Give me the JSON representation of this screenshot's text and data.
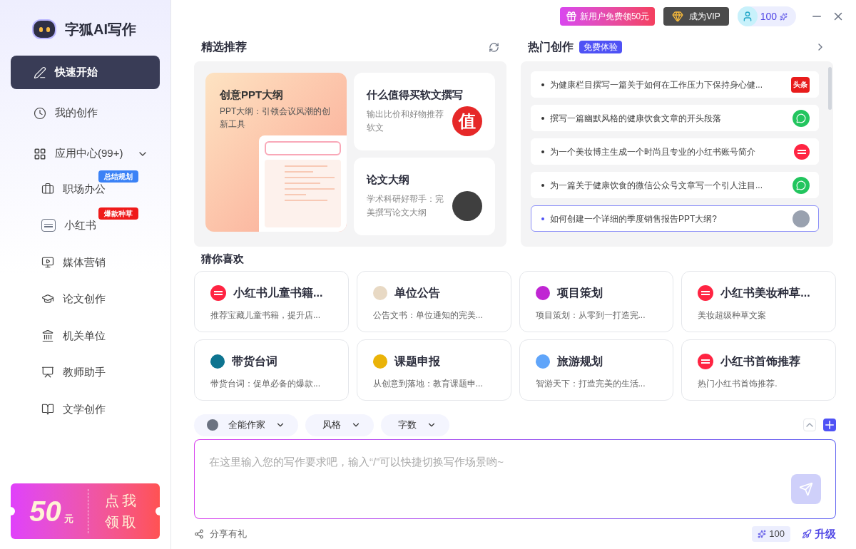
{
  "app": {
    "name": "字狐AI写作"
  },
  "sidebar": {
    "items": [
      {
        "label": "快速开始",
        "kind": "pen",
        "selected": true
      },
      {
        "label": "我的创作",
        "kind": "clock",
        "selected": false
      }
    ],
    "group": {
      "label": "应用中心(99+)",
      "expanded": true,
      "children": [
        {
          "label": "职场办公",
          "kind": "briefcase",
          "badge": "总结规划",
          "color": "#3b82f6"
        },
        {
          "label": "小红书",
          "kind": "note",
          "badge": "爆款种草",
          "color": "#ef1b1b"
        },
        {
          "label": "媒体营销",
          "kind": "video"
        },
        {
          "label": "论文创作",
          "kind": "cap"
        },
        {
          "label": "机关单位",
          "kind": "building"
        },
        {
          "label": "教师助手",
          "kind": "teacher"
        },
        {
          "label": "文学创作",
          "kind": "book"
        }
      ]
    },
    "coupon": {
      "amount": "50",
      "unit": "元",
      "action_lines": [
        "点我",
        "领取"
      ]
    }
  },
  "topbar": {
    "promo": "新用户免费领50元",
    "vip": "成为VIP",
    "credits": "100"
  },
  "featured": {
    "title": "精选推荐",
    "main_card": {
      "title": "创意PPT大纲",
      "desc": "PPT大纲：引领会议风潮的创新工具"
    },
    "cards": [
      {
        "title": "什么值得买软文撰写",
        "desc": "输出比价和好物推荐软文",
        "kind": "seal",
        "seal_text": "值"
      },
      {
        "title": "论文大纲",
        "desc": "学术科研好帮手：完美撰写论文大纲",
        "kind": "photo"
      }
    ]
  },
  "hot": {
    "title": "热门创作",
    "tag": "免费体验",
    "items": [
      {
        "text": "为健康栏目撰写一篇关于如何在工作压力下保持身心健...",
        "kind": "text_logo",
        "logo_text": "头条",
        "selected": false
      },
      {
        "text": "撰写一篇幽默风格的健康饮食文章的开头段落",
        "kind": "chat",
        "selected": false
      },
      {
        "text": "为一个美妆博主生成一个时尚且专业的小红书账号简介",
        "kind": "note",
        "selected": false
      },
      {
        "text": "为一篇关于健康饮食的微信公众号文章写一个引人注目...",
        "kind": "chat",
        "selected": false
      },
      {
        "text": "如何创建一个详细的季度销售报告PPT大纲?",
        "kind": "photo",
        "selected": true
      }
    ]
  },
  "guess": {
    "title": "猜你喜欢",
    "cards": [
      {
        "title": "小红书儿童书籍...",
        "desc": "推荐宝藏儿童书籍，提升店...",
        "kind": "note"
      },
      {
        "title": "单位公告",
        "desc": "公告文书：单位通知的完美...",
        "kind": "image",
        "color": "#e8d9c4"
      },
      {
        "title": "项目策划",
        "desc": "项目策划：从零到一打造完...",
        "kind": "image",
        "color": "#c026d3"
      },
      {
        "title": "小红书美妆种草...",
        "desc": "美妆超级种草文案",
        "kind": "note"
      },
      {
        "title": "带货台词",
        "desc": "带货台词：促单必备的爆款...",
        "kind": "image",
        "color": "#0e7490"
      },
      {
        "title": "课题申报",
        "desc": "从创意到落地：教育课题申...",
        "kind": "image",
        "color": "#eab308"
      },
      {
        "title": "旅游规划",
        "desc": "智游天下：打造完美的生活...",
        "kind": "image",
        "color": "#60a5fa"
      },
      {
        "title": "小红书首饰推荐",
        "desc": "热门小红书首饰推荐.",
        "kind": "note"
      }
    ]
  },
  "composer": {
    "chips": [
      {
        "label": "全能作家",
        "avatar": true
      },
      {
        "label": "风格",
        "avatar": false
      },
      {
        "label": "字数",
        "avatar": false
      }
    ],
    "placeholder": "在这里输入您的写作要求吧，输入“/”可以快捷切换写作场景哟~"
  },
  "footer": {
    "share": "分享有礼",
    "credits": "100",
    "upgrade": "升级"
  }
}
